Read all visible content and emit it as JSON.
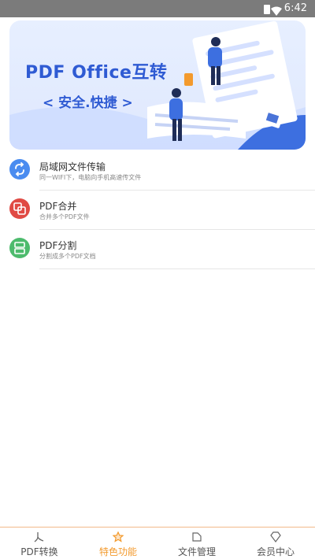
{
  "status": {
    "time": "6:42"
  },
  "banner": {
    "title": "PDF Office互转",
    "subtitle": "< 安全.快捷 >"
  },
  "features": [
    {
      "label": "局域网文件传输",
      "desc": "同一WIFI下，电脑向手机高速传文件",
      "icon": "transfer-icon",
      "color": "#4a8cf0"
    },
    {
      "label": "PDF合并",
      "desc": "合并多个PDF文件",
      "icon": "merge-icon",
      "color": "#e04a44"
    },
    {
      "label": "PDF分割",
      "desc": "分割成多个PDF文档",
      "icon": "split-icon",
      "color": "#4dbb6d"
    }
  ],
  "tabs": [
    {
      "label": "PDF转换",
      "icon": "pdf-convert-icon"
    },
    {
      "label": "特色功能",
      "icon": "featured-icon"
    },
    {
      "label": "文件管理",
      "icon": "folder-icon"
    },
    {
      "label": "会员中心",
      "icon": "diamond-icon"
    }
  ],
  "active_tab": "特色功能"
}
